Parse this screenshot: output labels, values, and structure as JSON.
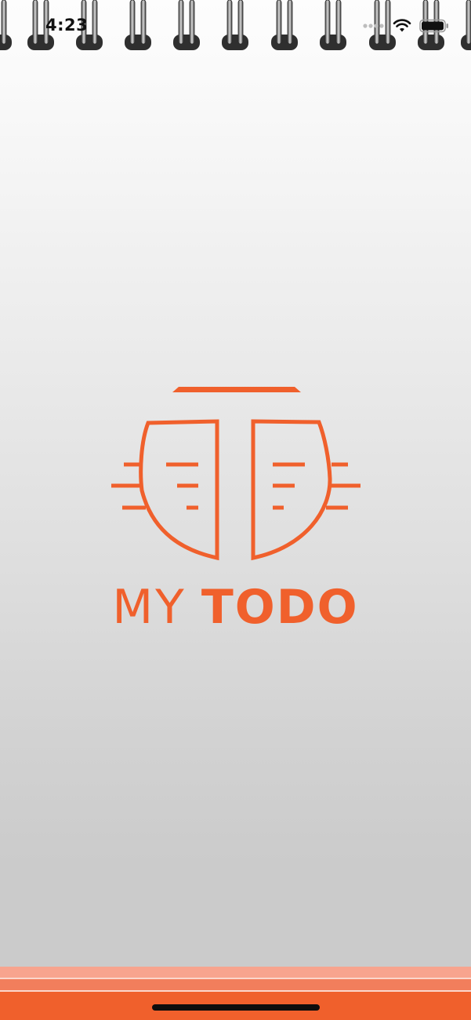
{
  "status_bar": {
    "time": "4:23",
    "icons": [
      "signal-dots-icon",
      "wifi-icon",
      "battery-icon"
    ]
  },
  "splash": {
    "logo_icon": "todo-t-logo-icon",
    "title_light": "MY",
    "title_bold": "TODO"
  },
  "colors": {
    "brand": "#f0602c",
    "stripe_light": "#f8a48e",
    "stripe_mid": "#f27e5c",
    "background_top": "#fdfdfd",
    "background_bottom": "#cbcbcb"
  }
}
